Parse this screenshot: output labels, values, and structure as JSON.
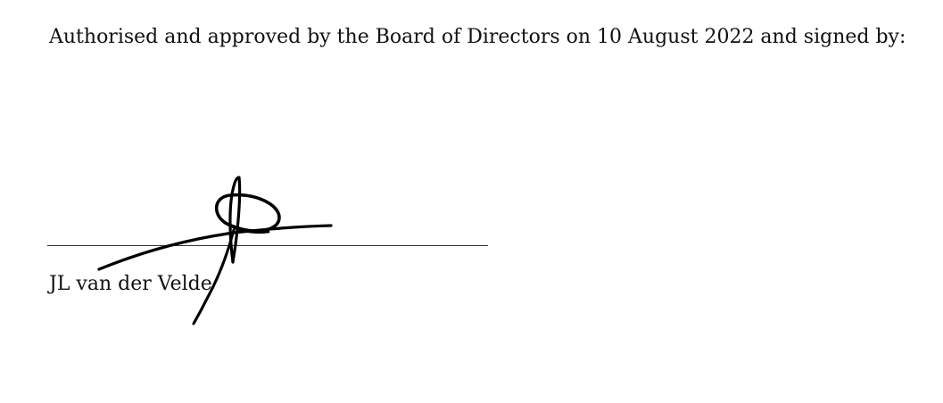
{
  "document": {
    "statement": "Authorised and approved by the Board of Directors on 10 August 2022 and signed by:",
    "signatory": {
      "name": "JL van der Velde"
    }
  }
}
